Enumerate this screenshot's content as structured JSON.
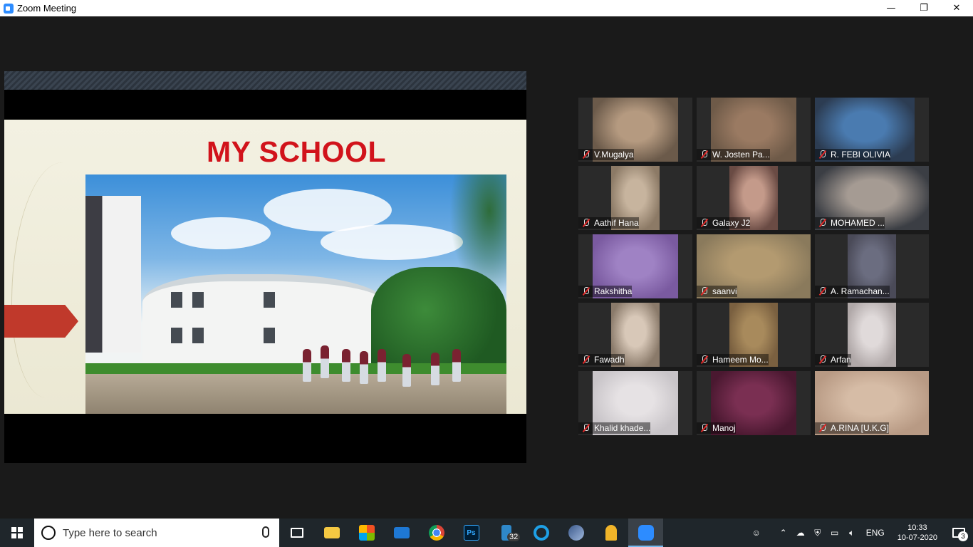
{
  "window": {
    "title": "Zoom Meeting",
    "minimize": "—",
    "restore": "❐",
    "close": "✕"
  },
  "slide": {
    "heading": "MY SCHOOL"
  },
  "participants": [
    {
      "name": "V.Mugalya",
      "bg": "#6b5a4a",
      "video": "#b59a80"
    },
    {
      "name": "W. Josten Pa...",
      "bg": "#6e5a48",
      "video": "#9a7a62"
    },
    {
      "name": "R. FEBI  OLIVIA",
      "bg": "#2c3c52",
      "video": "#4a7bb0"
    },
    {
      "name": "Aathif  Hana",
      "bg": "#8c7a66",
      "video": "#c7b49e"
    },
    {
      "name": "Galaxy J2",
      "bg": "#6a4b44",
      "video": "#c49a8a"
    },
    {
      "name": "MOHAMED ...",
      "bg": "#3b3e44",
      "video": "#a59b93"
    },
    {
      "name": "Rakshitha",
      "bg": "#7a5aa0",
      "video": "#9f82c4"
    },
    {
      "name": "saanvi",
      "bg": "#8a7a5c",
      "video": "#b39a70"
    },
    {
      "name": "A. Ramachan...",
      "bg": "#4a4a58",
      "video": "#6b6d80"
    },
    {
      "name": "Fawadh",
      "bg": "#8a7a6a",
      "video": "#d8c8b8"
    },
    {
      "name": "Hameem Mo...",
      "bg": "#7a6040",
      "video": "#a88a5c"
    },
    {
      "name": "Arfan",
      "bg": "#b0a8a8",
      "video": "#e0dada"
    },
    {
      "name": "Khalid khade...",
      "bg": "#c8c4c8",
      "video": "#e6e2e4"
    },
    {
      "name": "Manoj",
      "bg": "#4a1830",
      "video": "#7a2f52"
    },
    {
      "name": "A.RINA  [U.K.G]",
      "bg": "#b89a84",
      "video": "#d6bca6"
    }
  ],
  "taskbar": {
    "search_placeholder": "Type here to search",
    "files_badge": "32",
    "language": "ENG",
    "time": "10:33",
    "date": "10-07-2020",
    "notifications": "3"
  }
}
